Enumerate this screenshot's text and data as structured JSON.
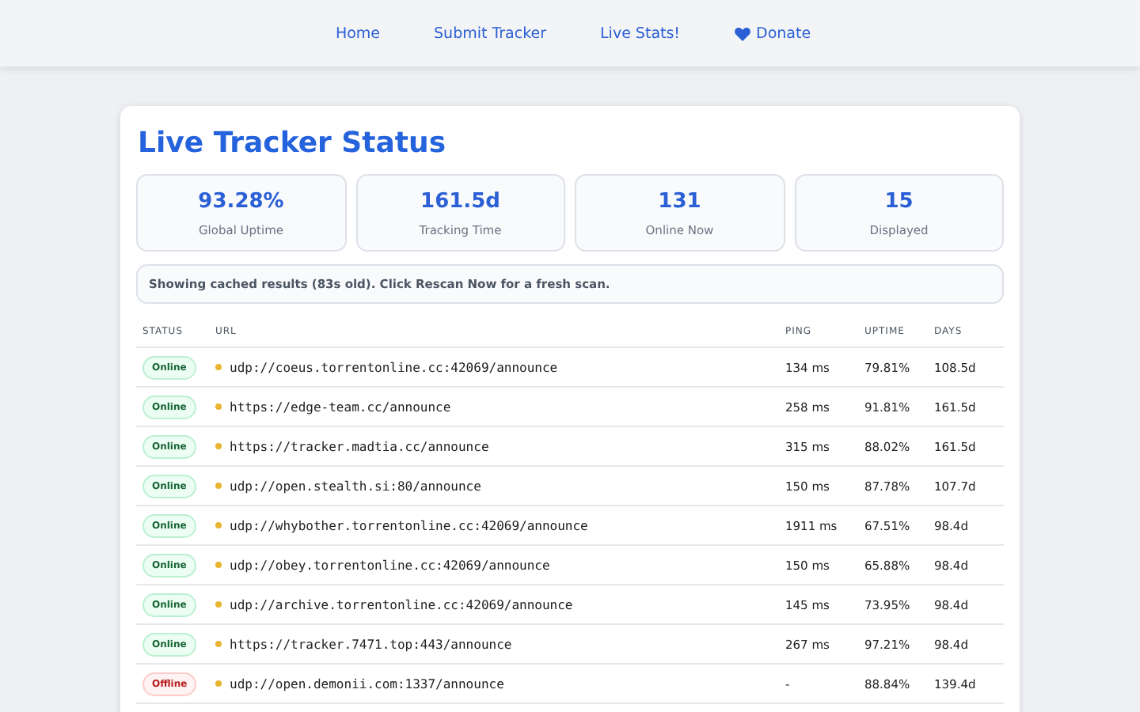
{
  "nav": [
    {
      "label": "Home",
      "icon": false
    },
    {
      "label": "Submit Tracker",
      "icon": false
    },
    {
      "label": "Live Stats!",
      "icon": false
    },
    {
      "label": "Donate",
      "icon": true
    }
  ],
  "title": "Live Tracker Status",
  "stats": [
    {
      "value": "93.28%",
      "label": "Global Uptime"
    },
    {
      "value": "161.5d",
      "label": "Tracking Time"
    },
    {
      "value": "131",
      "label": "Online Now"
    },
    {
      "value": "15",
      "label": "Displayed"
    }
  ],
  "notice": "Showing cached results (83s old). Click Rescan Now for a fresh scan.",
  "table": {
    "columns": [
      "STATUS",
      "URL",
      "PING",
      "UPTIME",
      "DAYS"
    ],
    "rows": [
      {
        "status": "Online",
        "kind": "online",
        "url": "udp://coeus.torrentonline.cc:42069/announce",
        "ping": "134 ms",
        "uptime": "79.81%",
        "days": "108.5d"
      },
      {
        "status": "Online",
        "kind": "online",
        "url": "https://edge-team.cc/announce",
        "ping": "258 ms",
        "uptime": "91.81%",
        "days": "161.5d"
      },
      {
        "status": "Online",
        "kind": "online",
        "url": "https://tracker.madtia.cc/announce",
        "ping": "315 ms",
        "uptime": "88.02%",
        "days": "161.5d"
      },
      {
        "status": "Online",
        "kind": "online",
        "url": "udp://open.stealth.si:80/announce",
        "ping": "150 ms",
        "uptime": "87.78%",
        "days": "107.7d"
      },
      {
        "status": "Online",
        "kind": "online",
        "url": "udp://whybother.torrentonline.cc:42069/announce",
        "ping": "1911 ms",
        "uptime": "67.51%",
        "days": "98.4d"
      },
      {
        "status": "Online",
        "kind": "online",
        "url": "udp://obey.torrentonline.cc:42069/announce",
        "ping": "150 ms",
        "uptime": "65.88%",
        "days": "98.4d"
      },
      {
        "status": "Online",
        "kind": "online",
        "url": "udp://archive.torrentonline.cc:42069/announce",
        "ping": "145 ms",
        "uptime": "73.95%",
        "days": "98.4d"
      },
      {
        "status": "Online",
        "kind": "online",
        "url": "https://tracker.7471.top:443/announce",
        "ping": "267 ms",
        "uptime": "97.21%",
        "days": "98.4d"
      },
      {
        "status": "Offline",
        "kind": "offline",
        "url": "udp://open.demonii.com:1337/announce",
        "ping": "-",
        "uptime": "88.84%",
        "days": "139.4d"
      }
    ]
  }
}
